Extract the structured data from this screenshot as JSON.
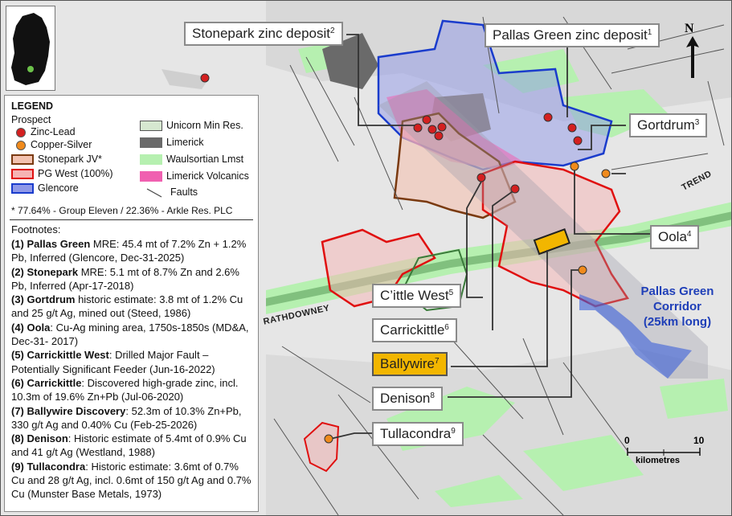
{
  "labels": {
    "stonepark": {
      "text": "Stonepark zinc deposit",
      "sup": "2"
    },
    "pallas": {
      "text": "Pallas Green zinc deposit",
      "sup": "1"
    },
    "gortdrum": {
      "text": "Gortdrum",
      "sup": "3"
    },
    "oola": {
      "text": "Oola",
      "sup": "4"
    },
    "cittle": {
      "text": "C’ittle West",
      "sup": "5"
    },
    "carrickittle": {
      "text": "Carrickittle",
      "sup": "6"
    },
    "ballywire": {
      "text": "Ballywire",
      "sup": "7"
    },
    "denison": {
      "text": "Denison",
      "sup": "8"
    },
    "tullacondra": {
      "text": "Tullacondra",
      "sup": "9"
    }
  },
  "north_label": "N",
  "corridor": {
    "line1": "Pallas Green",
    "line2": "Corridor",
    "line3": "(25km long)"
  },
  "map_text": {
    "trend": "TREND",
    "rathdowney": "RATHDOWNEY"
  },
  "scale": {
    "min": "0",
    "max": "10",
    "unit": "kilometres"
  },
  "legend": {
    "title": "LEGEND",
    "prospect_heading": "Prospect",
    "zinc_lead": "Zinc-Lead",
    "copper_silver": "Copper-Silver",
    "stonepark_jv": "Stonepark JV*",
    "pg_west": "PG West (100%)",
    "glencore": "Glencore",
    "unicorn": "Unicorn Min Res.",
    "limerick": "Limerick",
    "waulsortian": "Waulsortian Lmst",
    "volcanics": "Limerick Volcanics",
    "faults": "Faults",
    "ownership_note": "* 77.64% - Group Eleven / 22.36% - Arkle Res. PLC",
    "footnotes_title": "Footnotes:",
    "footnotes": [
      {
        "head": "(1) Pallas Green",
        "body": " MRE: 45.4 mt of 7.2% Zn + 1.2% Pb, Inferred (Glencore, Dec-31-2025)"
      },
      {
        "head": "(2) Stonepark",
        "body": " MRE:  5.1 mt of 8.7% Zn and 2.6% Pb, Inferred (Apr-17-2018)"
      },
      {
        "head": "(3) Gortdrum",
        "body": " historic estimate: 3.8 mt of 1.2% Cu and 25 g/t Ag, mined out (Steed, 1986)"
      },
      {
        "head": "(4) Oola",
        "body": ": Cu-Ag mining area, 1750s-1850s (MD&A, Dec-31- 2017)"
      },
      {
        "head": "(5) Carrickittle West",
        "body": ": Drilled Major Fault – Potentially Significant Feeder (Jun-16-2022)"
      },
      {
        "head": "(6) Carrickittle",
        "body": ": Discovered high-grade zinc, incl. 10.3m of 19.6% Zn+Pb (Jul-06-2020)"
      },
      {
        "head": "(7) Ballywire Discovery",
        "body": ": 52.3m of 10.3% Zn+Pb, 330 g/t Ag and 0.40% Cu (Feb-25-2026)"
      },
      {
        "head": "(8) Denison",
        "body": ": Historic estimate of 5.4mt of 0.9% Cu and 41 g/t Ag (Westland, 1988)"
      },
      {
        "head": "(9) Tullacondra",
        "body": ": Historic estimate: 3.6mt of 0.7% Cu and 28 g/t Ag, incl. 0.6mt of 150 g/t Ag and 0.7% Cu (Munster Base Metals, 1973)"
      }
    ]
  },
  "colors": {
    "zinc_lead": "#d42020",
    "copper_silver": "#f08a1c",
    "stonepark_fill": "#f3c2b0",
    "stonepark_border": "#7a3a10",
    "pg_west_fill": "#f6b4b4",
    "pg_west_border": "#e01010",
    "glencore_fill": "#8f98e8",
    "glencore_border": "#1a3ccc",
    "unicorn": "#d6e8d0",
    "limerick": "#6a6a6a",
    "waulsortian": "#b6f0b0",
    "volcanics": "#f060b0",
    "ballywire": "#f2b600",
    "corridor": "#1f3fb8"
  }
}
